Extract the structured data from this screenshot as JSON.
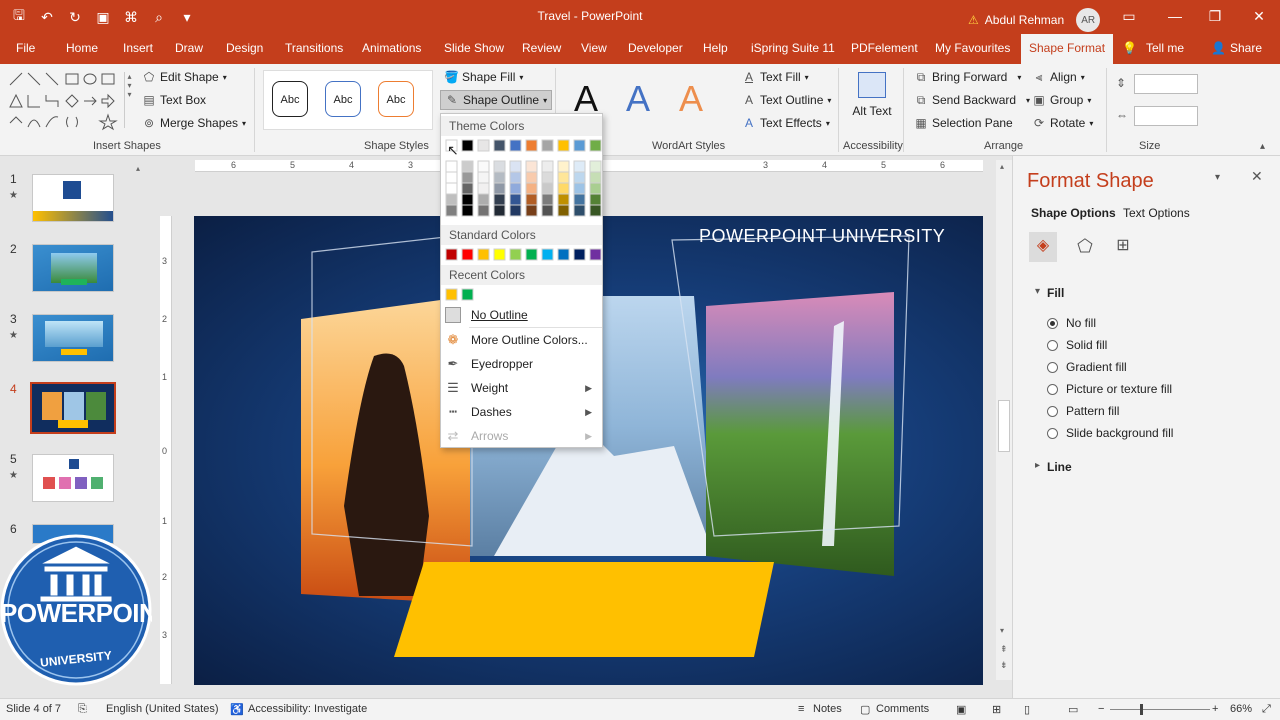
{
  "titlebar": {
    "doc_title": "Travel - PowerPoint",
    "user_name": "Abdul Rehman",
    "user_initials": "AR"
  },
  "tabs": [
    "File",
    "Home",
    "Insert",
    "Draw",
    "Design",
    "Transitions",
    "Animations",
    "Slide Show",
    "Review",
    "View",
    "Developer",
    "Help",
    "iSpring Suite 11",
    "PDFelement",
    "My Favourites",
    "Shape Format",
    "Tell me",
    "Share"
  ],
  "ribbon": {
    "insert_shapes": {
      "label": "Insert Shapes",
      "edit_shape": "Edit Shape",
      "text_box": "Text Box",
      "merge_shapes": "Merge Shapes"
    },
    "shape_styles": {
      "label": "Shape Styles",
      "sample": "Abc",
      "shape_fill": "Shape Fill",
      "shape_outline": "Shape Outline"
    },
    "wordart": {
      "label": "WordArt Styles",
      "glyph": "A",
      "text_fill": "Text Fill",
      "text_outline": "Text Outline",
      "text_effects": "Text Effects"
    },
    "accessibility": {
      "label": "Accessibility",
      "alt_text": "Alt Text"
    },
    "arrange": {
      "label": "Arrange",
      "bring_forward": "Bring Forward",
      "send_backward": "Send Backward",
      "selection_pane": "Selection Pane",
      "align": "Align",
      "group": "Group",
      "rotate": "Rotate"
    },
    "size": {
      "label": "Size"
    }
  },
  "dropdown": {
    "theme_colors_heading": "Theme Colors",
    "standard_colors_heading": "Standard Colors",
    "recent_colors_heading": "Recent Colors",
    "theme_top": [
      "#ffffff",
      "#000000",
      "#e7e6e6",
      "#44546a",
      "#4472c4",
      "#ed7d31",
      "#a5a5a5",
      "#ffc000",
      "#5b9bd5",
      "#70ad47"
    ],
    "standard": [
      "#c00000",
      "#ff0000",
      "#ffc000",
      "#ffff00",
      "#92d050",
      "#00b050",
      "#00b0f0",
      "#0070c0",
      "#002060",
      "#7030a0"
    ],
    "recent": [
      "#ffc000",
      "#00b050"
    ],
    "items": {
      "no_outline": "No Outline",
      "more_colors": "More Outline Colors...",
      "eyedropper": "Eyedropper",
      "weight": "Weight",
      "dashes": "Dashes",
      "arrows": "Arrows"
    }
  },
  "thumbnails": [
    {
      "num": "1",
      "star": "★"
    },
    {
      "num": "2",
      "star": ""
    },
    {
      "num": "3",
      "star": "★"
    },
    {
      "num": "4",
      "star": ""
    },
    {
      "num": "5",
      "star": "★"
    },
    {
      "num": "6",
      "star": ""
    }
  ],
  "slide": {
    "title": "POWERPOINT UNIVERSITY"
  },
  "pane": {
    "title": "Format Shape",
    "tab_shape_options": "Shape Options",
    "tab_text_options": "Text Options",
    "fill_section": "Fill",
    "line_section": "Line",
    "fill_options": [
      "No fill",
      "Solid fill",
      "Gradient fill",
      "Picture or texture fill",
      "Pattern fill",
      "Slide background fill"
    ],
    "selected_fill": 0
  },
  "status": {
    "slide_info": "Slide 4 of 7",
    "language": "English (United States)",
    "accessibility": "Accessibility: Investigate",
    "notes": "Notes",
    "comments": "Comments",
    "zoom": "66%"
  },
  "logo": {
    "line1": "POWERPOINT",
    "line2": "UNIVERSITY"
  },
  "colors": {
    "accent": "#c43e1c",
    "slide_band": "#ffc000"
  }
}
